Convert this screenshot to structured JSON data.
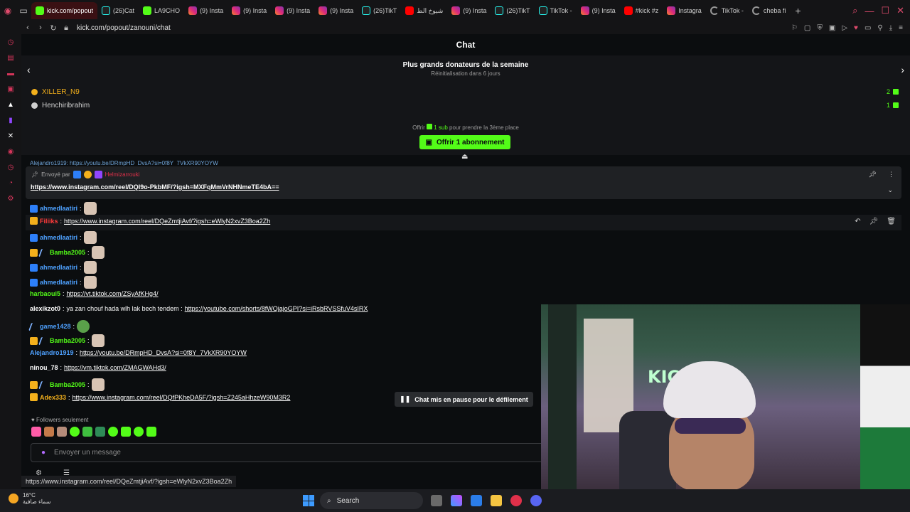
{
  "browser": {
    "tabs": [
      {
        "label": "kick.com/popout",
        "fav": "fav-k",
        "active": true
      },
      {
        "label": "(26)Cat",
        "fav": "fav-tt"
      },
      {
        "label": "LA9CHO",
        "fav": "fav-k"
      },
      {
        "label": "(9) Insta",
        "fav": "fav-ig"
      },
      {
        "label": "(9) Insta",
        "fav": "fav-ig"
      },
      {
        "label": "(9) Insta",
        "fav": "fav-ig"
      },
      {
        "label": "(9) Insta",
        "fav": "fav-ig"
      },
      {
        "label": "(26)TikT",
        "fav": "fav-tt"
      },
      {
        "label": "شيوخ الط",
        "fav": "fav-yt"
      },
      {
        "label": "(9) Insta",
        "fav": "fav-ig"
      },
      {
        "label": "(26)TikT",
        "fav": "fav-tt"
      },
      {
        "label": "TikTok -",
        "fav": "fav-tt"
      },
      {
        "label": "(9) Insta",
        "fav": "fav-ig"
      },
      {
        "label": "#kick #z",
        "fav": "fav-yt"
      },
      {
        "label": "Instagra",
        "fav": "fav-ig"
      },
      {
        "label": "TikTok -",
        "fav": "fav-ld"
      },
      {
        "label": "cheba fi",
        "fav": "fav-ld"
      }
    ],
    "url": "kick.com/popout/zanouni/chat",
    "status_url": "https://www.instagram.com/reel/DQeZmtjiAvf/?igsh=eWlyN2xvZ3Boa2Zh"
  },
  "chat": {
    "title": "Chat",
    "donors": {
      "title": "Plus grands donateurs de la semaine",
      "subtitle": "Réinitialisation dans 6 jours",
      "list": [
        {
          "name": "XILLER_N9",
          "count": "2",
          "color": "#f3b01c"
        },
        {
          "name": "Henchiribrahim",
          "count": "1",
          "color": "#cfcfcf"
        }
      ],
      "offer_prefix": "Offrir",
      "offer_highlight": "1 sub",
      "offer_suffix": "pour prendre la 3ème place",
      "offer_button": "Offrir 1 abonnement"
    },
    "cut_line": "Alejandro1919: https://youtu.be/DRmpHD_DvsA?si=0f8Y_7VkXR90YOYW",
    "pinned": {
      "sent_by": "Envoyé par",
      "author": "Helmizarrouki",
      "link": "https://www.instagram.com/reel/DQl9o-PkbMF/?igsh=MXFqMmVrNHNmeTE4bA=="
    },
    "messages": [
      {
        "user": "ahmedlaatiri",
        "color": "#4ea1ff",
        "text": "",
        "link": "",
        "emote": true,
        "badges": [
          "b-blue"
        ]
      },
      {
        "user": "Filiiks",
        "color": "#ff3b3b",
        "text": "",
        "link": "https://www.instagram.com/reel/DQeZmtjiAvf/?igsh=eWlyN2xvZ3Boa2Zh",
        "emote": false,
        "badges": [
          "b-gold"
        ]
      },
      {
        "user": "ahmedlaatiri",
        "color": "#4ea1ff",
        "text": "",
        "link": "",
        "emote": true,
        "badges": [
          "b-blue"
        ]
      },
      {
        "user": "Bamba2005",
        "color": "#53fc18",
        "text": "",
        "link": "",
        "emote": true,
        "badges": [
          "b-gold",
          "b-sword"
        ]
      },
      {
        "user": "ahmedlaatiri",
        "color": "#4ea1ff",
        "text": "",
        "link": "",
        "emote": true,
        "badges": [
          "b-blue"
        ]
      },
      {
        "user": "ahmedlaatiri",
        "color": "#4ea1ff",
        "text": "",
        "link": "",
        "emote": true,
        "badges": [
          "b-blue"
        ]
      },
      {
        "user": "harbaoui5",
        "color": "#53fc18",
        "text": "",
        "link": "https://vt.tiktok.com/ZSyAfKHg4/",
        "emote": false,
        "badges": []
      },
      {
        "user": "alexikzot0",
        "color": "#ffffff",
        "text": "ya zan chouf hada wlh lak bech tendem :",
        "link": "https://youtube.com/shorts/8fWQjajoGPI?si=iRsbRVSSfuV4sIRX",
        "emote": false,
        "badges": []
      },
      {
        "user": "game1428",
        "color": "#4ea1ff",
        "text": "",
        "link": "",
        "emote": true,
        "frog": true,
        "badges": [
          "b-sword"
        ]
      },
      {
        "user": "Bamba2005",
        "color": "#53fc18",
        "text": "",
        "link": "",
        "emote": true,
        "badges": [
          "b-gold",
          "b-sword"
        ]
      },
      {
        "user": "Alejandro1919",
        "color": "#4ea1ff",
        "text": "",
        "link": "https://youtu.be/DRmpHD_DvsA?si=0f8Y_7VkXR90YOYW",
        "emote": false,
        "badges": []
      },
      {
        "user": "ninou_78",
        "color": "#ffffff",
        "text": "",
        "link": "https://vm.tiktok.com/ZMAGWAHd3/",
        "emote": false,
        "badges": []
      },
      {
        "user": "Bamba2005",
        "color": "#53fc18",
        "text": "",
        "link": "",
        "emote": true,
        "badges": [
          "b-gold",
          "b-sword"
        ]
      },
      {
        "user": "Adex333",
        "color": "#f3b01c",
        "text": "",
        "link": "https://www.instagram.com/reel/DQfPKheDA5F/?igsh=Z245aHhzeW90M3R2",
        "emote": false,
        "badges": [
          "b-gold"
        ]
      }
    ],
    "paused_label": "Chat mis en pause pour le défilement",
    "followers_label": "Followers seulement",
    "input_placeholder": "Envoyer un message"
  },
  "colors": {
    "accent": "#53fc18",
    "background": "#0b0d0f",
    "browser_accent": "#e04b6d"
  },
  "taskbar": {
    "temperature": "16°C",
    "condition": "سماء صافية",
    "search_label": "Search"
  }
}
